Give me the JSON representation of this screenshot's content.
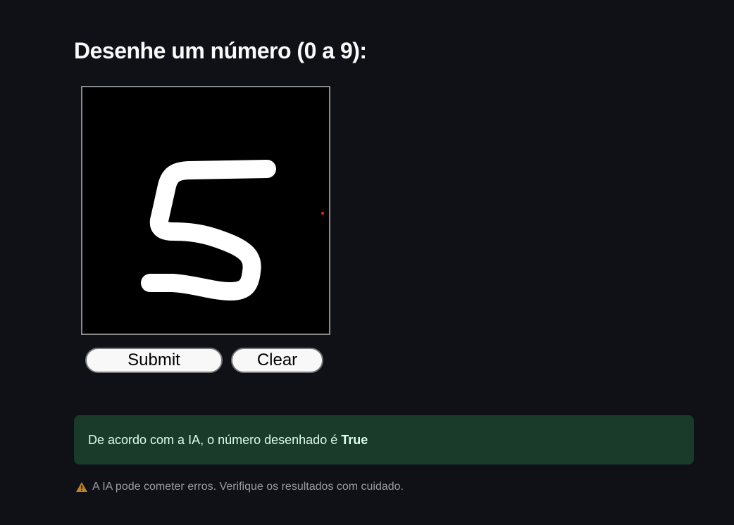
{
  "page": {
    "title": "Desenhe um número (0 a 9):"
  },
  "canvas": {
    "stroke_color": "#ffffff",
    "background_color": "#000000",
    "cursor_dot_color": "#e0281e"
  },
  "buttons": {
    "submit_label": "Submit",
    "clear_label": "Clear"
  },
  "result": {
    "text": "De acordo com a IA, o número desenhado é",
    "value": "True",
    "background_color": "#1a3a2a"
  },
  "caption": {
    "icon": "warning-icon",
    "text": "A IA pode cometer erros. Verifique os resultados com cuidado."
  }
}
